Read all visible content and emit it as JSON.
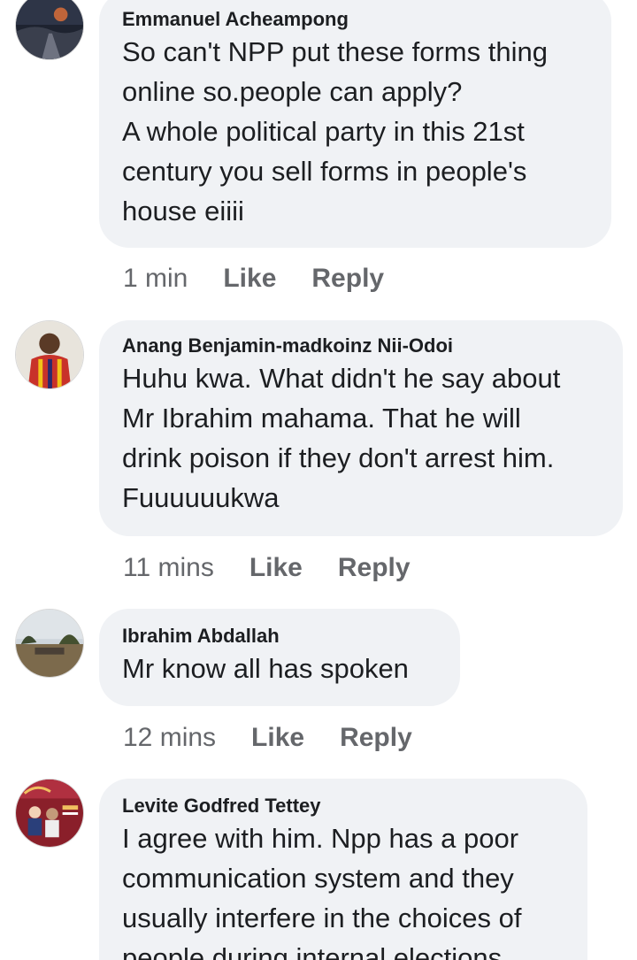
{
  "comments": [
    {
      "author": "Emmanuel Acheampong",
      "text": "So can't NPP put these forms thing\nonline so.people can apply?\nA whole political party in this 21st\ncentury  you sell forms in people's\nhouse eiiii",
      "time": "1 min",
      "like_label": "Like",
      "reply_label": "Reply",
      "avatar_icon": "night-road-landscape"
    },
    {
      "author": "Anang Benjamin-madkoinz Nii-Odoi",
      "text": "Huhu kwa. What didn't he say about\nMr Ibrahim mahama. That he will\ndrink poison if they don't arrest him.\nFuuuuuukwa",
      "time": "11 mins",
      "like_label": "Like",
      "reply_label": "Reply",
      "avatar_icon": "person-in-jersey"
    },
    {
      "author": "Ibrahim Abdallah",
      "text": "Mr know all has spoken",
      "time": "12 mins",
      "like_label": "Like",
      "reply_label": "Reply",
      "avatar_icon": "field-with-trees"
    },
    {
      "author": "Levite Godfred Tettey",
      "text": "I agree with him. Npp has a poor\ncommunication system and they\nusually interfere in the choices of\npeople during internal elections",
      "avatar_icon": "event-flyer"
    }
  ]
}
